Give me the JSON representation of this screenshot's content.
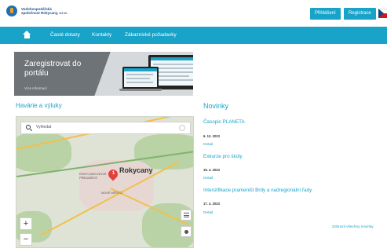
{
  "header": {
    "logo_line1": "Vodohospodářská",
    "logo_line2": "společnost Rokycany, s.r.o.",
    "login_label": "Přihlášení",
    "register_label": "Registrace",
    "language_flag": "cz-flag-icon"
  },
  "nav": {
    "home_icon": "home-icon",
    "items": [
      {
        "label": "Časté dotazy"
      },
      {
        "label": "Kontakty"
      },
      {
        "label": "Zákaznické požadavky"
      }
    ]
  },
  "banner": {
    "title": "Zaregistrovat do portálu",
    "more_label": "Více informací"
  },
  "outages": {
    "heading": "Havárie a výluky",
    "search_placeholder": "Vyhledat",
    "city_label": "Rokycany",
    "marker_count": "1",
    "place_labels": [
      "ROKYCANY-NOVÉ PŘEDMĚSTÍ",
      "NOVÉ MĚSTO"
    ],
    "zoom_in": "+",
    "zoom_out": "−"
  },
  "news": {
    "heading": "Novinky",
    "items": [
      {
        "title": "Časopis PLANETA",
        "date": "6. 12. 2023",
        "detail": "Detail"
      },
      {
        "title": "Exkurze pro školy",
        "date": "19. 4. 2023",
        "detail": "Detail"
      },
      {
        "title": "Intenzifikace prameništ Brdy a nadregionální řady",
        "date": "17. 4. 2023",
        "detail": "Detail"
      }
    ],
    "all_news_label": "Zobrazit všechny novinky"
  },
  "colors": {
    "accent": "#1aa3c8",
    "banner_bg": "#6e7377",
    "marker": "#e2413b"
  }
}
